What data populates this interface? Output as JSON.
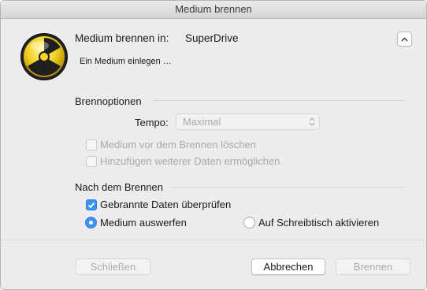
{
  "window": {
    "title": "Medium brennen"
  },
  "header": {
    "burn_in_label": "Medium brennen in:",
    "device": "SuperDrive",
    "status": "Ein Medium einlegen …"
  },
  "burn_options": {
    "heading": "Brennoptionen",
    "speed_label": "Tempo:",
    "speed_value": "Maximal",
    "erase_label": "Medium vor dem Brennen löschen",
    "erase_checked": false,
    "append_label": "Hinzufügen weiterer Daten ermöglichen",
    "append_checked": false
  },
  "after_burn": {
    "heading": "Nach dem Brennen",
    "verify_label": "Gebrannte Daten überprüfen",
    "verify_checked": true,
    "eject_label": "Medium auswerfen",
    "eject_selected": true,
    "mount_label": "Auf Schreibtisch aktivieren",
    "mount_selected": false
  },
  "buttons": {
    "close": "Schließen",
    "cancel": "Abbrechen",
    "burn": "Brennen"
  },
  "icons": {
    "burn": "burn-radiation-icon",
    "disclosure": "chevron-up-icon",
    "popup_arrows": "up-down-arrows-icon",
    "checkmark": "checkmark-icon"
  },
  "colors": {
    "accent": "#3b93f7",
    "window_bg": "#ececec"
  }
}
